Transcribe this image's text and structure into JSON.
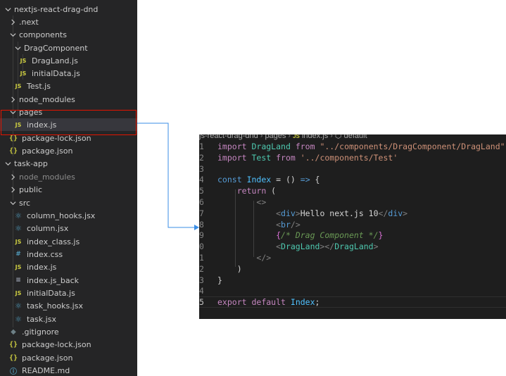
{
  "explorer": {
    "items": [
      {
        "label": "nextjs-react-drag-dnd",
        "icon": "chevron-down",
        "type": "folder-open"
      },
      {
        "label": ".next",
        "icon": "chevron-right",
        "type": "folder"
      },
      {
        "label": "components",
        "icon": "chevron-down",
        "type": "folder-open"
      },
      {
        "label": "DragComponent",
        "icon": "chevron-down",
        "type": "folder-open"
      },
      {
        "label": "DragLand.js",
        "icon": "js",
        "type": "file"
      },
      {
        "label": "initialData.js",
        "icon": "js",
        "type": "file"
      },
      {
        "label": "Test.js",
        "icon": "js",
        "type": "file"
      },
      {
        "label": "node_modules",
        "icon": "chevron-right",
        "type": "folder"
      },
      {
        "label": "pages",
        "icon": "chevron-down",
        "type": "folder-open"
      },
      {
        "label": "index.js",
        "icon": "js",
        "type": "file"
      },
      {
        "label": "package-lock.json",
        "icon": "json",
        "type": "file"
      },
      {
        "label": "package.json",
        "icon": "json",
        "type": "file"
      },
      {
        "label": "task-app",
        "icon": "chevron-down",
        "type": "folder-open"
      },
      {
        "label": "node_modules",
        "icon": "chevron-right",
        "type": "folder"
      },
      {
        "label": "public",
        "icon": "chevron-right",
        "type": "folder"
      },
      {
        "label": "src",
        "icon": "chevron-down",
        "type": "folder-open"
      },
      {
        "label": "column_hooks.jsx",
        "icon": "react",
        "type": "file"
      },
      {
        "label": "column.jsx",
        "icon": "react",
        "type": "file"
      },
      {
        "label": "index_class.js",
        "icon": "js",
        "type": "file"
      },
      {
        "label": "index.css",
        "icon": "css",
        "type": "file"
      },
      {
        "label": "index.js",
        "icon": "js",
        "type": "file"
      },
      {
        "label": "index.js_back",
        "icon": "file",
        "type": "file"
      },
      {
        "label": "initialData.js",
        "icon": "js",
        "type": "file"
      },
      {
        "label": "task_hooks.jsx",
        "icon": "react",
        "type": "file"
      },
      {
        "label": "task.jsx",
        "icon": "react",
        "type": "file"
      },
      {
        "label": ".gitignore",
        "icon": "git",
        "type": "file"
      },
      {
        "label": "package-lock.json",
        "icon": "json",
        "type": "file"
      },
      {
        "label": "package.json",
        "icon": "json",
        "type": "file"
      },
      {
        "label": "README.md",
        "icon": "info",
        "type": "file"
      }
    ],
    "icon_glyphs": {
      "js": "JS",
      "json": "{}",
      "react": "⚛",
      "css": "#",
      "file": "≡",
      "git": "◆",
      "info": "ⓘ"
    }
  },
  "editor": {
    "breadcrumb": {
      "folder": "js-react-drag-dnd",
      "sub": "pages",
      "file_icon": "JS",
      "file": "index.js",
      "symbol": "default",
      "separator": "›"
    },
    "lines": [
      {
        "n": "1",
        "tokens": [
          [
            "kw",
            "import"
          ],
          [
            "txt",
            " "
          ],
          [
            "comp",
            "DragLand"
          ],
          [
            "txt",
            " "
          ],
          [
            "kw",
            "from"
          ],
          [
            "txt",
            " "
          ],
          [
            "str",
            "\"../components/DragComponent/DragLand\""
          ]
        ]
      },
      {
        "n": "2",
        "tokens": [
          [
            "kw",
            "import"
          ],
          [
            "txt",
            " "
          ],
          [
            "comp",
            "Test"
          ],
          [
            "txt",
            " "
          ],
          [
            "kw",
            "from"
          ],
          [
            "txt",
            " "
          ],
          [
            "str",
            "'../components/Test'"
          ]
        ]
      },
      {
        "n": "3",
        "tokens": []
      },
      {
        "n": "4",
        "tokens": [
          [
            "kwb",
            "const"
          ],
          [
            "txt",
            " "
          ],
          [
            "var",
            "Index"
          ],
          [
            "txt",
            " "
          ],
          [
            "op",
            "="
          ],
          [
            "txt",
            " () "
          ],
          [
            "kwb",
            "=>"
          ],
          [
            "txt",
            " {"
          ]
        ]
      },
      {
        "n": "5",
        "tokens": [
          [
            "txt",
            "    "
          ],
          [
            "kw",
            "return"
          ],
          [
            "txt",
            " ("
          ]
        ]
      },
      {
        "n": "6",
        "tokens": [
          [
            "txt",
            "        "
          ],
          [
            "br",
            "<>"
          ]
        ]
      },
      {
        "n": "7",
        "tokens": [
          [
            "txt",
            "            "
          ],
          [
            "br",
            "<"
          ],
          [
            "tag",
            "div"
          ],
          [
            "br",
            ">"
          ],
          [
            "txt",
            "Hello next.js 10"
          ],
          [
            "br",
            "</"
          ],
          [
            "tag",
            "div"
          ],
          [
            "br",
            ">"
          ]
        ]
      },
      {
        "n": "8",
        "tokens": [
          [
            "txt",
            "            "
          ],
          [
            "br",
            "<"
          ],
          [
            "tag",
            "br"
          ],
          [
            "br",
            "/>"
          ]
        ]
      },
      {
        "n": "9",
        "tokens": [
          [
            "txt",
            "            "
          ],
          [
            "brace",
            "{"
          ],
          [
            "cmt",
            "/* Drag Component */"
          ],
          [
            "brace",
            "}"
          ]
        ]
      },
      {
        "n": "0",
        "tokens": [
          [
            "txt",
            "            "
          ],
          [
            "br",
            "<"
          ],
          [
            "comp",
            "DragLand"
          ],
          [
            "br",
            "></"
          ],
          [
            "comp",
            "DragLand"
          ],
          [
            "br",
            ">"
          ]
        ]
      },
      {
        "n": "1",
        "tokens": [
          [
            "txt",
            "        "
          ],
          [
            "br",
            "</>"
          ]
        ]
      },
      {
        "n": "2",
        "tokens": [
          [
            "txt",
            "    )"
          ]
        ]
      },
      {
        "n": "3",
        "tokens": [
          [
            "txt",
            "}"
          ]
        ]
      },
      {
        "n": "4",
        "tokens": []
      },
      {
        "n": "5",
        "tokens": [
          [
            "kw",
            "export"
          ],
          [
            "txt",
            " "
          ],
          [
            "kw",
            "default"
          ],
          [
            "txt",
            " "
          ],
          [
            "var",
            "Index"
          ],
          [
            "txt",
            ";"
          ]
        ]
      }
    ],
    "current_line_number": "5"
  },
  "colors": {
    "sidebar_bg": "#252526",
    "editor_bg": "#1e1e1e",
    "highlight_border": "#e51400",
    "connector": "#3a8ee6"
  }
}
